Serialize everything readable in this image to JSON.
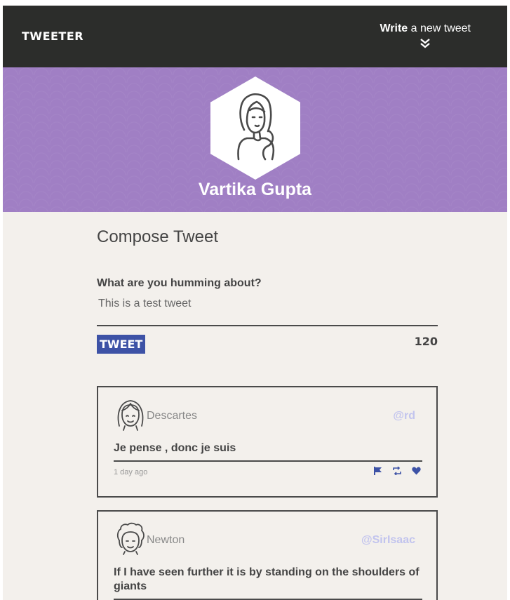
{
  "nav": {
    "brand": "TWEETER",
    "write_bold": "Write",
    "write_rest": " a new tweet"
  },
  "profile": {
    "name": "Vartika Gupta"
  },
  "compose": {
    "title": "Compose Tweet",
    "label": "What are you humming about?",
    "value": "This is a test tweet",
    "button_label": "TWEET",
    "counter": "120"
  },
  "tweets": [
    {
      "author": "Descartes",
      "handle": "@rd",
      "content": "Je pense , donc je suis",
      "age": "1 day ago"
    },
    {
      "author": "Newton",
      "handle": "@SirIsaac",
      "content": "If I have seen further it is by standing on the shoulders of giants"
    }
  ],
  "colors": {
    "navbar": "#2c2d2b",
    "header": "#a07fc4",
    "accent": "#3d52a6",
    "handle": "#c2c4ee",
    "background": "#f3f0ec"
  },
  "icons": {
    "write_toggle": "double-chevron-down-icon",
    "flag": "flag-icon",
    "retweet": "retweet-icon",
    "like": "heart-icon"
  }
}
